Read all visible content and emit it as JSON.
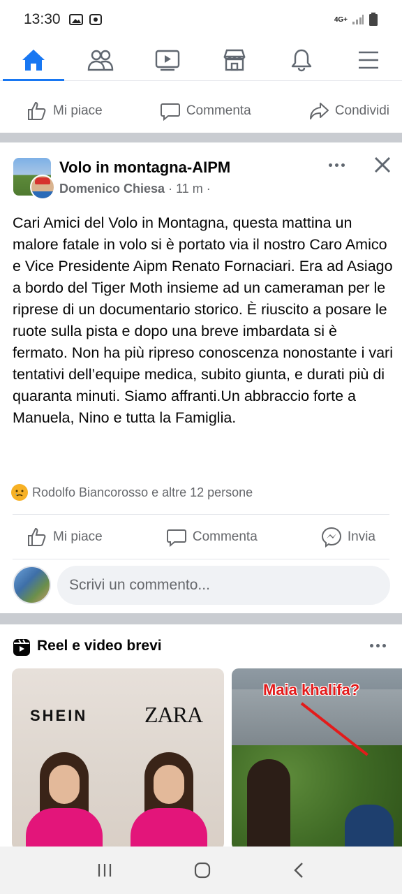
{
  "status_bar": {
    "time": "13:30",
    "network": "4G+",
    "icons": [
      "image-icon",
      "notification-icon",
      "signal-icon",
      "battery-icon"
    ]
  },
  "nav": {
    "items": [
      {
        "name": "home",
        "icon": "home-icon",
        "active": true
      },
      {
        "name": "friends",
        "icon": "friends-icon",
        "active": false
      },
      {
        "name": "watch",
        "icon": "video-icon",
        "active": false
      },
      {
        "name": "marketplace",
        "icon": "store-icon",
        "active": false
      },
      {
        "name": "notifications",
        "icon": "bell-icon",
        "active": false
      },
      {
        "name": "menu",
        "icon": "menu-icon",
        "active": false
      }
    ],
    "accent_color": "#1877f2"
  },
  "prev_post_actions": {
    "like": "Mi piace",
    "comment": "Commenta",
    "share": "Condividi"
  },
  "post": {
    "group_name": "Volo in montagna-AIPM",
    "author": "Domenico Chiesa",
    "time": "11 m",
    "separator": "·",
    "text": "Cari Amici del Volo in Montagna, questa mattina un malore fatale in volo si è portato via il nostro Caro Amico e Vice Presidente Aipm Renato Fornaciari. Era ad Asiago a bordo del Tiger Moth insieme ad un cameraman per le riprese di un documentario storico. È riuscito a posare le ruote sulla pista e dopo una breve imbardata si è fermato. Non ha più ripreso conoscenza nonostante i vari tentativi dell’equipe medica, subito giunta, e durati più di quaranta minuti. Siamo affranti.Un abbraccio forte a Manuela, Nino e tutta la Famiglia.",
    "reactions_text": "Rodolfo Biancorosso e altre 12 persone",
    "reaction_icon": "sad-emoji-icon",
    "actions": {
      "like": "Mi piace",
      "comment": "Commenta",
      "send": "Invia"
    },
    "comment_placeholder": "Scrivi un commento..."
  },
  "reels": {
    "title": "Reel e video brevi",
    "cards": [
      {
        "brand_left": "SHEIN",
        "brand_right": "ZARA"
      },
      {
        "overlay_text": "Maia khalifa?"
      }
    ]
  }
}
